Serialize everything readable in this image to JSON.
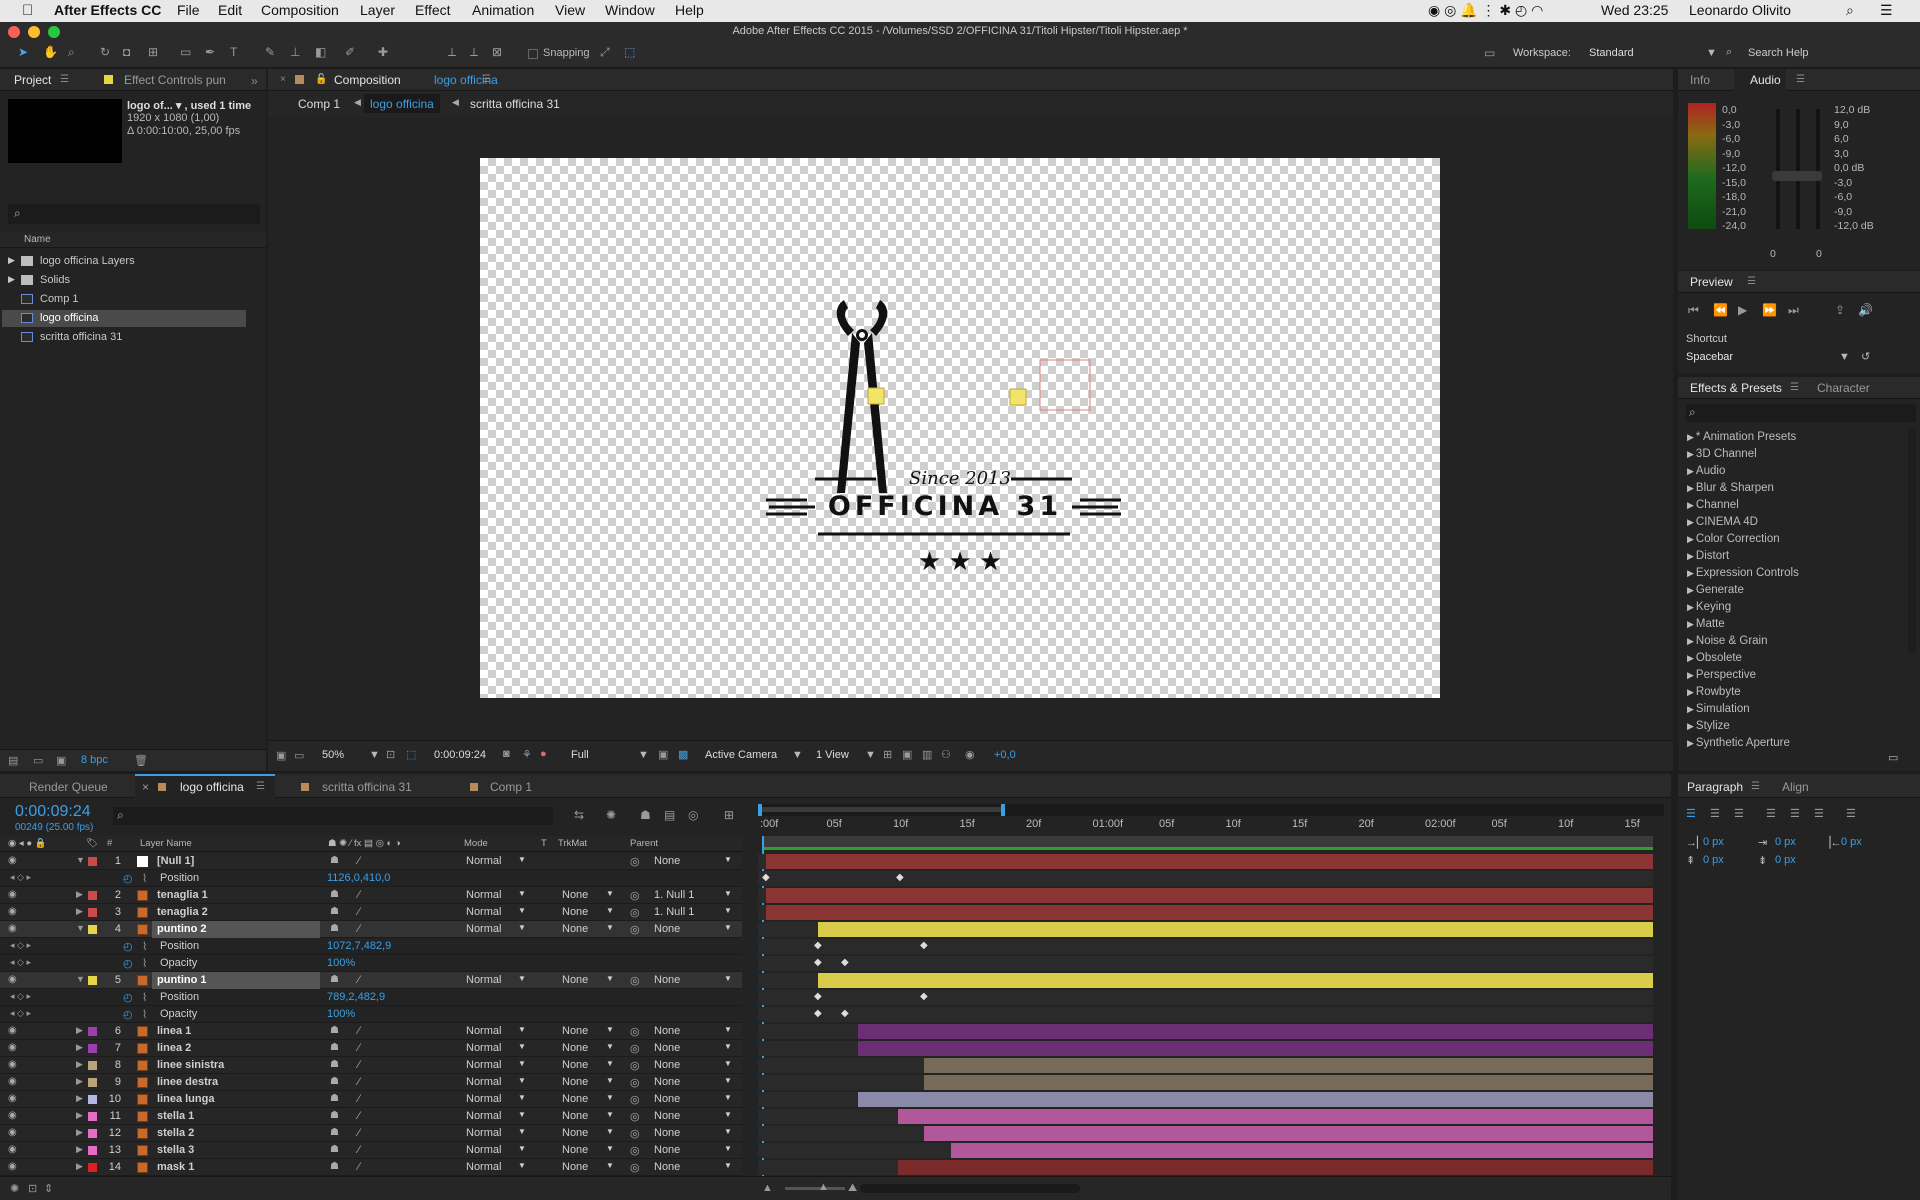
{
  "menubar": {
    "app": "After Effects CC",
    "items": [
      "File",
      "Edit",
      "Composition",
      "Layer",
      "Effect",
      "Animation",
      "View",
      "Window",
      "Help"
    ],
    "clock": "Wed 23:25",
    "user": "Leonardo Olivito"
  },
  "titlebar": {
    "title": "Adobe After Effects CC 2015 - /Volumes/SSD 2/OFFICINA 31/Titoli Hipster/Titoli Hipster.aep *"
  },
  "toolbar": {
    "snapping": "Snapping",
    "workspace_label": "Workspace:",
    "workspace": "Standard",
    "search": "Search Help"
  },
  "project": {
    "tab": "Project",
    "tab2": "Effect Controls pun",
    "comp_name": "logo of... ▾ , used 1 time",
    "comp_res": "1920 x 1080 (1,00)",
    "comp_dur": "Δ 0:00:10:00, 25,00 fps",
    "col_name": "Name",
    "items": [
      {
        "name": "logo officina Layers",
        "type": "folder"
      },
      {
        "name": "Solids",
        "type": "folder"
      },
      {
        "name": "Comp 1",
        "type": "comp"
      },
      {
        "name": "logo officina",
        "type": "comp",
        "selected": true
      },
      {
        "name": "scritta officina 31",
        "type": "comp"
      }
    ],
    "bpc": "8 bpc"
  },
  "viewer": {
    "tab_prefix": "Composition",
    "tab_comp": "logo officina",
    "breadcrumbs": [
      "Comp 1",
      "logo officina",
      "scritta officina 31"
    ],
    "logo_since": "Since 2013",
    "logo_title": "OFFICINA 31",
    "logo_stars": "★ ★ ★",
    "zoom": "50%",
    "timecode": "0:00:09:24",
    "resolution": "Full",
    "camera": "Active Camera",
    "views": "1 View",
    "exposure": "+0,0"
  },
  "info": {
    "tab_info": "Info",
    "tab_audio": "Audio",
    "left_db": [
      "0,0",
      "-3,0",
      "-6,0",
      "-9,0",
      "-12,0",
      "-15,0",
      "-18,0",
      "-21,0",
      "-24,0"
    ],
    "right_db": [
      "12,0 dB",
      "9,0",
      "6,0",
      "3,0",
      "0,0 dB",
      "-3,0",
      "-6,0",
      "-9,0",
      "-12,0 dB"
    ],
    "zero_l": "0",
    "zero_r": "0"
  },
  "preview": {
    "title": "Preview",
    "shortcut_label": "Shortcut",
    "shortcut": "Spacebar"
  },
  "effects": {
    "tab": "Effects & Presets",
    "tab2": "Character",
    "items": [
      "* Animation Presets",
      "3D Channel",
      "Audio",
      "Blur & Sharpen",
      "Channel",
      "CINEMA 4D",
      "Color Correction",
      "Distort",
      "Expression Controls",
      "Generate",
      "Keying",
      "Matte",
      "Noise & Grain",
      "Obsolete",
      "Perspective",
      "Rowbyte",
      "Simulation",
      "Stylize",
      "Synthetic Aperture"
    ]
  },
  "timeline": {
    "tabs": [
      "Render Queue",
      "logo officina",
      "scritta officina 31",
      "Comp 1"
    ],
    "timecode": "0:00:09:24",
    "frames": "00249 (25.00 fps)",
    "cols": {
      "layer": "Layer Name",
      "mode": "Mode",
      "t": "T",
      "trkmat": "TrkMat",
      "parent": "Parent"
    },
    "ruler": [
      ":00f",
      "05f",
      "10f",
      "15f",
      "20f",
      "01:00f",
      "05f",
      "10f",
      "15f",
      "20f",
      "02:00f",
      "05f",
      "10f",
      "15f"
    ],
    "rows": [
      {
        "kind": "layer",
        "num": "1",
        "name": "[Null 1]",
        "color": "#c84a4a",
        "mode": "Normal",
        "trk": "",
        "parent": "None",
        "expanded": true,
        "null": true
      },
      {
        "kind": "prop",
        "name": "Position",
        "value": "1126,0,410,0"
      },
      {
        "kind": "layer",
        "num": "2",
        "name": "tenaglia 1",
        "color": "#c84a4a",
        "mode": "Normal",
        "trk": "None",
        "parent": "1. Null 1"
      },
      {
        "kind": "layer",
        "num": "3",
        "name": "tenaglia 2",
        "color": "#c84a4a",
        "mode": "Normal",
        "trk": "None",
        "parent": "1. Null 1"
      },
      {
        "kind": "layer",
        "num": "4",
        "name": "puntino 2",
        "color": "#e6d54a",
        "mode": "Normal",
        "trk": "None",
        "parent": "None",
        "expanded": true,
        "sel": true
      },
      {
        "kind": "prop",
        "name": "Position",
        "value": "1072,7,482,9"
      },
      {
        "kind": "prop",
        "name": "Opacity",
        "value": "100%"
      },
      {
        "kind": "layer",
        "num": "5",
        "name": "puntino 1",
        "color": "#e6d54a",
        "mode": "Normal",
        "trk": "None",
        "parent": "None",
        "expanded": true,
        "sel": true
      },
      {
        "kind": "prop",
        "name": "Position",
        "value": "789,2,482,9"
      },
      {
        "kind": "prop",
        "name": "Opacity",
        "value": "100%"
      },
      {
        "kind": "layer",
        "num": "6",
        "name": "linea 1",
        "color": "#9b3fae",
        "mode": "Normal",
        "trk": "None",
        "parent": "None"
      },
      {
        "kind": "layer",
        "num": "7",
        "name": "linea 2",
        "color": "#9b3fae",
        "mode": "Normal",
        "trk": "None",
        "parent": "None"
      },
      {
        "kind": "layer",
        "num": "8",
        "name": "linee sinistra",
        "color": "#b9a37a",
        "mode": "Normal",
        "trk": "None",
        "parent": "None"
      },
      {
        "kind": "layer",
        "num": "9",
        "name": "linee destra",
        "color": "#b9a37a",
        "mode": "Normal",
        "trk": "None",
        "parent": "None"
      },
      {
        "kind": "layer",
        "num": "10",
        "name": "linea lunga",
        "color": "#b6b6e6",
        "mode": "Normal",
        "trk": "None",
        "parent": "None"
      },
      {
        "kind": "layer",
        "num": "11",
        "name": "stella 1",
        "color": "#e36ec6",
        "mode": "Normal",
        "trk": "None",
        "parent": "None"
      },
      {
        "kind": "layer",
        "num": "12",
        "name": "stella 2",
        "color": "#e36ec6",
        "mode": "Normal",
        "trk": "None",
        "parent": "None"
      },
      {
        "kind": "layer",
        "num": "13",
        "name": "stella 3",
        "color": "#e36ec6",
        "mode": "Normal",
        "trk": "None",
        "parent": "None"
      },
      {
        "kind": "layer",
        "num": "14",
        "name": "mask 1",
        "color": "#e02020",
        "mode": "Normal",
        "trk": "None",
        "parent": "None"
      }
    ]
  },
  "paragraph": {
    "tab": "Paragraph",
    "tab2": "Align",
    "v1": "0 px",
    "v2": "0 px",
    "v3": "0 px",
    "v4": "0 px",
    "v5": "0 px"
  }
}
